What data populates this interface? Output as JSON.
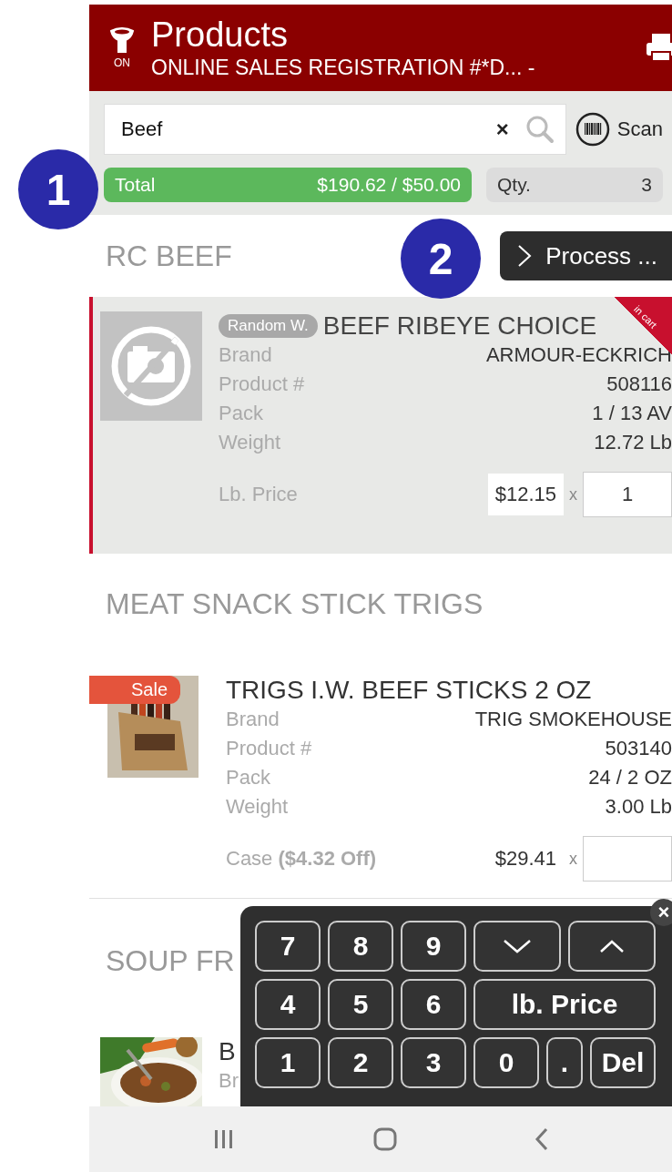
{
  "header": {
    "filter_on": true,
    "filter_label": "ON",
    "title": "Products",
    "subtitle": "ONLINE SALES REGISTRATION #*D... -"
  },
  "search": {
    "value": "Beef",
    "clear": "×",
    "scan_label": "Scan"
  },
  "total": {
    "label": "Total",
    "value": "$190.62 / $50.00"
  },
  "qty": {
    "label": "Qty.",
    "value": "3"
  },
  "annotations": [
    {
      "label": "1"
    },
    {
      "label": "2"
    }
  ],
  "sections": [
    {
      "title": "RC BEEF",
      "action": "Process ...",
      "products": [
        {
          "kind": "no_photo",
          "in_cart": true,
          "cart_label": "in cart",
          "badge": "Random W.",
          "name": "BEEF RIBEYE CHOICE",
          "details": [
            {
              "label": "Brand",
              "value": "ARMOUR-ECKRICH"
            },
            {
              "label": "Product #",
              "value": "508116"
            },
            {
              "label": "Pack",
              "value": "1 / 13 AV"
            },
            {
              "label": "Weight",
              "value": "12.72 Lb"
            }
          ],
          "price_label": "Lb. Price",
          "price": "$12.15",
          "multiply": "x",
          "quantity": "1"
        }
      ]
    },
    {
      "title": "MEAT SNACK STICK TRIGS",
      "products": [
        {
          "kind": "picture",
          "in_cart": false,
          "sale_label": "Sale",
          "name": "TRIGS I.W. BEEF STICKS 2 OZ",
          "details": [
            {
              "label": "Brand",
              "value": "TRIG SMOKEHOUSE"
            },
            {
              "label": "Product #",
              "value": "503140"
            },
            {
              "label": "Pack",
              "value": "24 / 2 OZ"
            },
            {
              "label": "Weight",
              "value": "3.00 Lb"
            }
          ],
          "price_label": "Case **($4.32 Off)**",
          "price": "$29.41",
          "multiply": "x"
        }
      ]
    },
    {
      "title": "SOUP FR",
      "products": [
        {
          "kind": "picture",
          "in_cart": false,
          "name": "B",
          "details": [
            {
              "label": "Br"
            }
          ]
        }
      ]
    }
  ],
  "keypad": {
    "close": "×",
    "keys": [
      {
        "kind": "digit",
        "label": "7"
      },
      {
        "kind": "digit",
        "label": "8"
      },
      {
        "kind": "digit",
        "label": "9"
      },
      {
        "kind": "down"
      },
      {
        "kind": "up"
      },
      {
        "kind": "digit",
        "label": "4"
      },
      {
        "kind": "digit",
        "label": "5"
      },
      {
        "kind": "digit",
        "label": "6"
      },
      {
        "kind": "wide",
        "label": "lb. Price"
      },
      {
        "kind": "digit",
        "label": "1"
      },
      {
        "kind": "digit",
        "label": "2"
      },
      {
        "kind": "digit",
        "label": "3"
      },
      {
        "kind": "digit",
        "label": "0"
      },
      {
        "kind": "point",
        "label": "."
      },
      {
        "kind": "delete",
        "label": "Del"
      }
    ]
  }
}
